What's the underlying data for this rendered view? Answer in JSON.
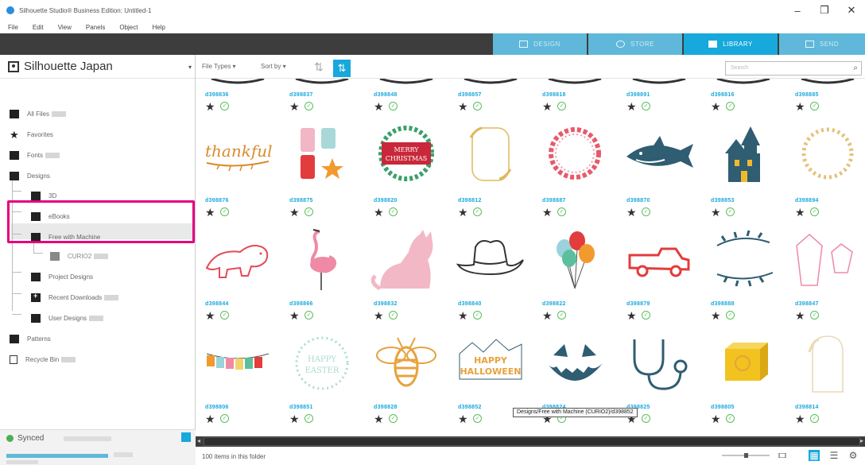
{
  "window": {
    "title": "Silhouette Studio® Business Edition: Untitled-1",
    "controls": [
      "–",
      "❐",
      "✕"
    ]
  },
  "menu": [
    "File",
    "Edit",
    "View",
    "Panels",
    "Object",
    "Help"
  ],
  "tabs": [
    {
      "label": "DESIGN",
      "icon": "design-icon",
      "active": false
    },
    {
      "label": "STORE",
      "icon": "store-icon",
      "active": false
    },
    {
      "label": "LIBRARY",
      "icon": "library-icon",
      "active": true
    },
    {
      "label": "SEND",
      "icon": "send-icon",
      "active": false
    }
  ],
  "library": {
    "title": "Silhouette Japan",
    "tree": [
      {
        "label": "All Files",
        "icon": "folder-icon",
        "level": 0
      },
      {
        "label": "Favorites",
        "icon": "star-icon",
        "level": 0
      },
      {
        "label": "Fonts",
        "icon": "folder-icon",
        "level": 0
      },
      {
        "label": "Designs",
        "icon": "folder-icon",
        "level": 0
      },
      {
        "label": "3D",
        "icon": "folder-icon",
        "level": 1
      },
      {
        "label": "eBooks",
        "icon": "folder-icon",
        "level": 1
      },
      {
        "label": "Free with Machine",
        "icon": "folder-icon",
        "level": 1
      },
      {
        "label": "CURIO2",
        "icon": "folder-icon",
        "level": 2
      },
      {
        "label": "Project Designs",
        "icon": "folder-icon",
        "level": 1
      },
      {
        "label": "Recent Downloads",
        "icon": "folder-plus-icon",
        "level": 1
      },
      {
        "label": "User Designs",
        "icon": "folder-icon",
        "level": 1
      },
      {
        "label": "Patterns",
        "icon": "folder-icon",
        "level": 0
      },
      {
        "label": "Recycle Bin",
        "icon": "trash-icon",
        "level": 0
      }
    ],
    "synced_label": "Synced"
  },
  "toolbar": {
    "file_types": "File Types ▾",
    "sort_by": "Sort by ▾",
    "search_placeholder": "Search",
    "search_icon": "⌕"
  },
  "status": {
    "items_text": "100 items in this folder"
  },
  "tooltip": "Designs/Free with Machine (CURIO2)/d398852",
  "colors": {
    "accent": "#17a8dc",
    "tab_inactive": "#5fb8d9",
    "dark_bar": "#3d3d3d",
    "highlight": "#e5007f",
    "id_text": "#17a8dc"
  },
  "grid": [
    {
      "id": "d398836",
      "thumb": "partial-shape"
    },
    {
      "id": "d398837",
      "thumb": "partial-shape"
    },
    {
      "id": "d398848",
      "thumb": "partial-shape"
    },
    {
      "id": "d398857",
      "thumb": "partial-shape"
    },
    {
      "id": "d398818",
      "thumb": "partial-shape"
    },
    {
      "id": "d398891",
      "thumb": "partial-shape"
    },
    {
      "id": "d398816",
      "thumb": "partial-shape"
    },
    {
      "id": "d398885",
      "thumb": "partial-shape"
    },
    {
      "id": "d398876",
      "thumb": "thankful"
    },
    {
      "id": "d398875",
      "thumb": "gift-tags"
    },
    {
      "id": "d398820",
      "thumb": "merry-christmas"
    },
    {
      "id": "d398812",
      "thumb": "gold-frame"
    },
    {
      "id": "d398887",
      "thumb": "floral-wreath"
    },
    {
      "id": "d398870",
      "thumb": "shark"
    },
    {
      "id": "d398853",
      "thumb": "haunted-house"
    },
    {
      "id": "d398894",
      "thumb": "gold-wreath"
    },
    {
      "id": "d398844",
      "thumb": "dinosaur"
    },
    {
      "id": "d398866",
      "thumb": "flamingo"
    },
    {
      "id": "d398832",
      "thumb": "cat"
    },
    {
      "id": "d398840",
      "thumb": "cowboy-hat"
    },
    {
      "id": "d398822",
      "thumb": "balloons"
    },
    {
      "id": "d398879",
      "thumb": "truck"
    },
    {
      "id": "d398888",
      "thumb": "branches"
    },
    {
      "id": "d398847",
      "thumb": "crystals"
    },
    {
      "id": "d398806",
      "thumb": "banner"
    },
    {
      "id": "d398851",
      "thumb": "happy-easter"
    },
    {
      "id": "d398828",
      "thumb": "bee"
    },
    {
      "id": "d398852",
      "thumb": "happy-halloween"
    },
    {
      "id": "d398824",
      "thumb": "pumpkin-face"
    },
    {
      "id": "d398825",
      "thumb": "stethoscope"
    },
    {
      "id": "d398805",
      "thumb": "yellow-box"
    },
    {
      "id": "d398814",
      "thumb": "arch-frame"
    }
  ]
}
